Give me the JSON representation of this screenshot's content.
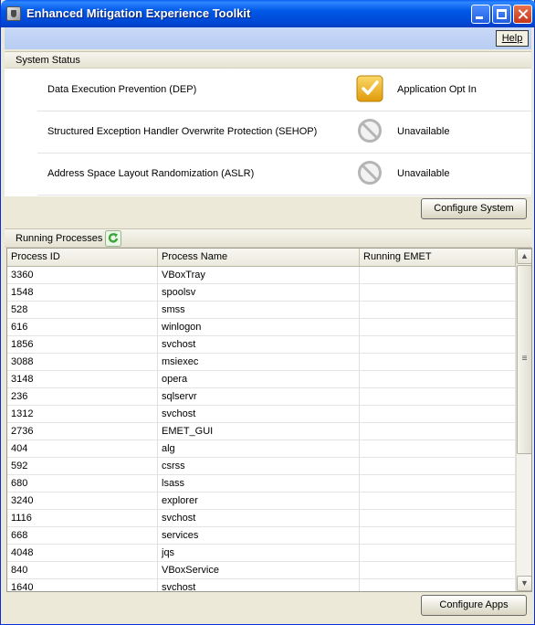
{
  "window": {
    "title": "Enhanced Mitigation Experience Toolkit"
  },
  "menu": {
    "help_label": "Help"
  },
  "system_status": {
    "header": "System Status",
    "items": [
      {
        "name": "Data Execution Prevention (DEP)",
        "icon": "checkmark-icon",
        "value": "Application Opt In"
      },
      {
        "name": "Structured Exception Handler Overwrite Protection (SEHOP)",
        "icon": "unavailable-icon",
        "value": "Unavailable"
      },
      {
        "name": "Address Space Layout Randomization (ASLR)",
        "icon": "unavailable-icon",
        "value": "Unavailable"
      }
    ],
    "configure_button": "Configure System"
  },
  "processes": {
    "header": "Running Processes",
    "columns": [
      "Process ID",
      "Process Name",
      "Running EMET"
    ],
    "rows": [
      {
        "pid": "3360",
        "name": "VBoxTray",
        "emet": ""
      },
      {
        "pid": "1548",
        "name": "spoolsv",
        "emet": ""
      },
      {
        "pid": "528",
        "name": "smss",
        "emet": ""
      },
      {
        "pid": "616",
        "name": "winlogon",
        "emet": ""
      },
      {
        "pid": "1856",
        "name": "svchost",
        "emet": ""
      },
      {
        "pid": "3088",
        "name": "msiexec",
        "emet": ""
      },
      {
        "pid": "3148",
        "name": "opera",
        "emet": ""
      },
      {
        "pid": "236",
        "name": "sqlservr",
        "emet": ""
      },
      {
        "pid": "1312",
        "name": "svchost",
        "emet": ""
      },
      {
        "pid": "2736",
        "name": "EMET_GUI",
        "emet": ""
      },
      {
        "pid": "404",
        "name": "alg",
        "emet": ""
      },
      {
        "pid": "592",
        "name": "csrss",
        "emet": ""
      },
      {
        "pid": "680",
        "name": "lsass",
        "emet": ""
      },
      {
        "pid": "3240",
        "name": "explorer",
        "emet": ""
      },
      {
        "pid": "1116",
        "name": "svchost",
        "emet": ""
      },
      {
        "pid": "668",
        "name": "services",
        "emet": ""
      },
      {
        "pid": "4048",
        "name": "jqs",
        "emet": ""
      },
      {
        "pid": "840",
        "name": "VBoxService",
        "emet": ""
      },
      {
        "pid": "1640",
        "name": "svchost",
        "emet": ""
      }
    ],
    "configure_button": "Configure Apps"
  },
  "colors": {
    "title_bar": "#0058e6",
    "menu_bar": "#c1d3f5",
    "panel": "#ece9d8",
    "check_icon": "#f2b51c",
    "unavailable_icon": "#b5b5b5",
    "refresh_icon": "#3aa63a"
  }
}
